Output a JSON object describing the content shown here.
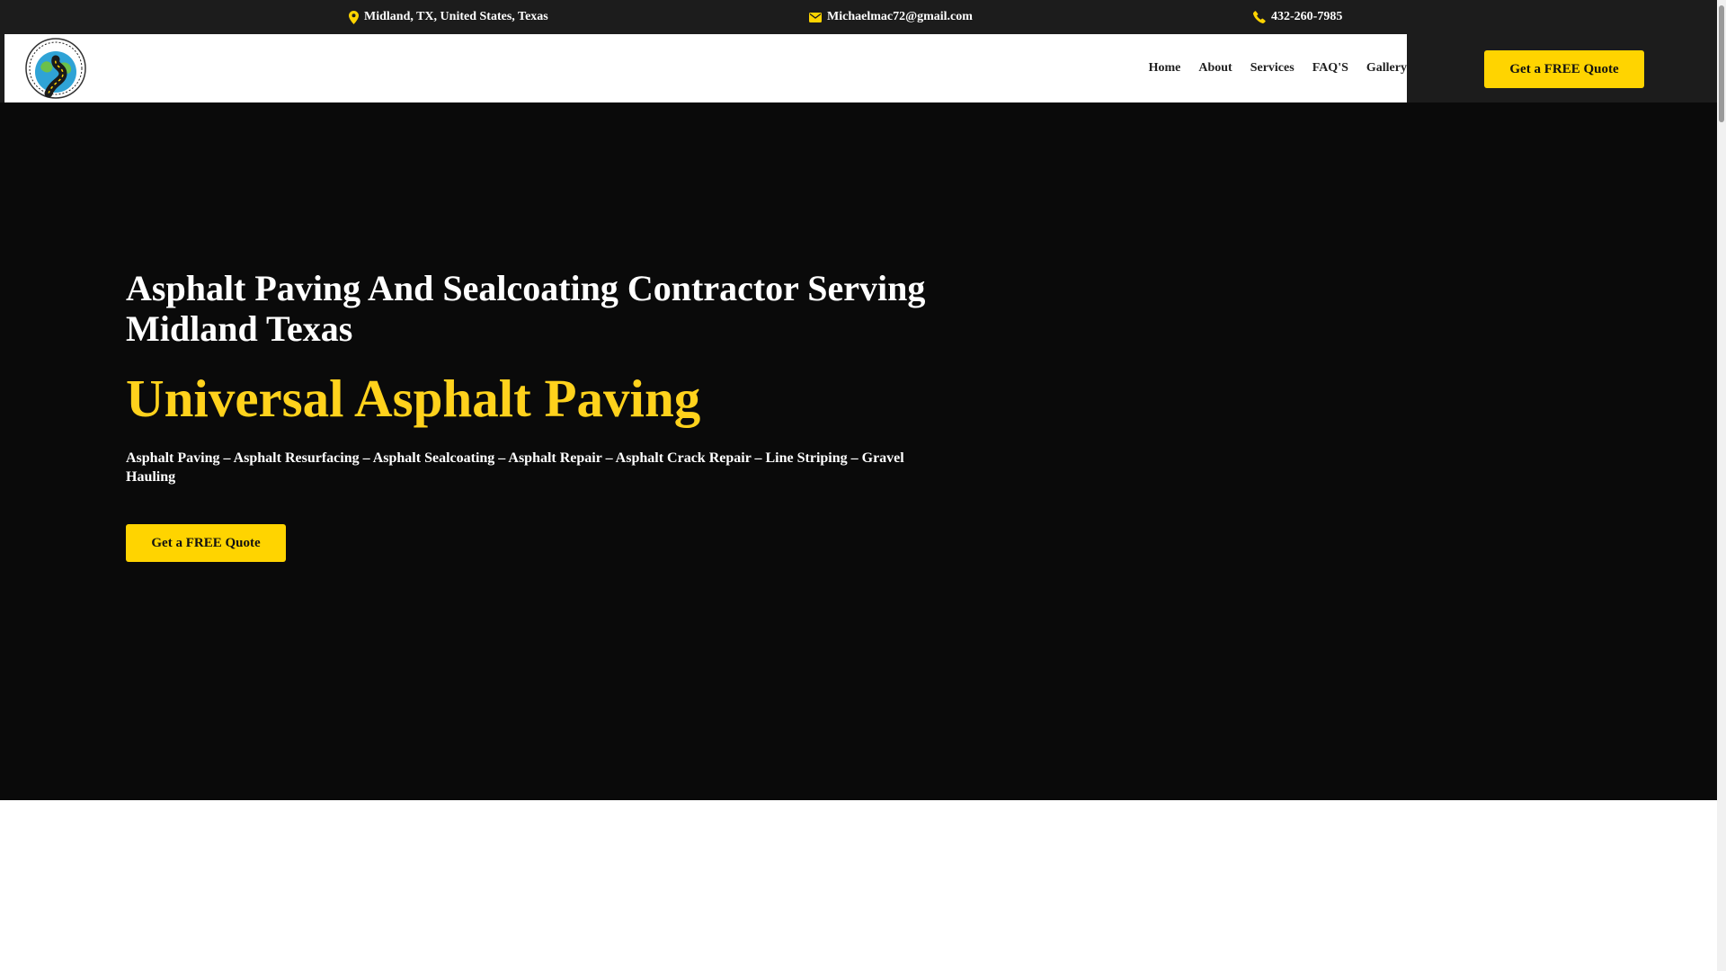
{
  "topbar": {
    "location": "Midland, TX, United States, Texas",
    "email": "Michaelmac72@gmail.com",
    "phone": "432-260-7985",
    "icon_color": "#ffd400"
  },
  "header": {
    "logo_icon": "universal-asphalt-paving-logo",
    "nav": [
      {
        "label": "Home"
      },
      {
        "label": "About"
      },
      {
        "label": "Services"
      },
      {
        "label": "FAQ'S"
      },
      {
        "label": "Gallery"
      }
    ],
    "cta_label": "Get a FREE Quote"
  },
  "hero": {
    "heading": "Asphalt Paving And Sealcoating Contractor Serving Midland Texas",
    "brand": "Universal Asphalt Paving",
    "services": "Asphalt Paving – Asphalt Resurfacing – Asphalt Sealcoating – Asphalt Repair – Asphalt Crack Repair – Line Striping – Gravel Hauling",
    "cta_label": "Get a FREE Quote",
    "accent_color": "#ffd21c"
  }
}
